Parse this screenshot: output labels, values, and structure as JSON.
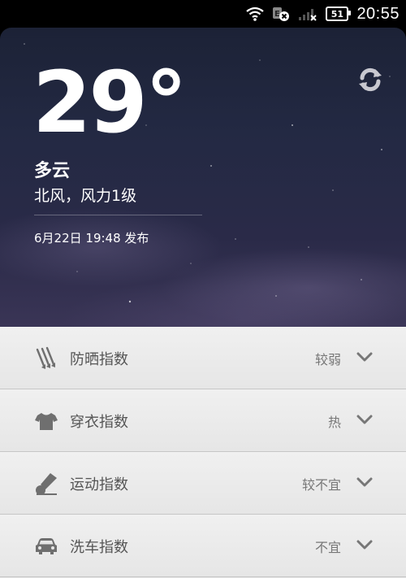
{
  "status_bar": {
    "time": "20:55",
    "battery": "51",
    "icons": [
      "wifi-icon",
      "edge-data-icon",
      "signal-icon",
      "battery-icon"
    ]
  },
  "weather": {
    "temperature": "29°",
    "condition": "多云",
    "wind": "北风，风力1级",
    "updated": "6月22日 19:48 发布",
    "refresh_icon": "refresh-icon"
  },
  "indices": [
    {
      "label": "防晒指数",
      "value": "较弱",
      "icon": "sunscreen-icon"
    },
    {
      "label": "穿衣指数",
      "value": "热",
      "icon": "tshirt-icon"
    },
    {
      "label": "运动指数",
      "value": "较不宜",
      "icon": "badminton-shuttlecock-icon"
    },
    {
      "label": "洗车指数",
      "value": "不宜",
      "icon": "car-icon"
    }
  ],
  "colors": {
    "sky_top": "#1c2236",
    "sky_bottom": "#3a3556",
    "list_bg": "#e6e6e6",
    "icon_gray": "#6f6f6f"
  }
}
